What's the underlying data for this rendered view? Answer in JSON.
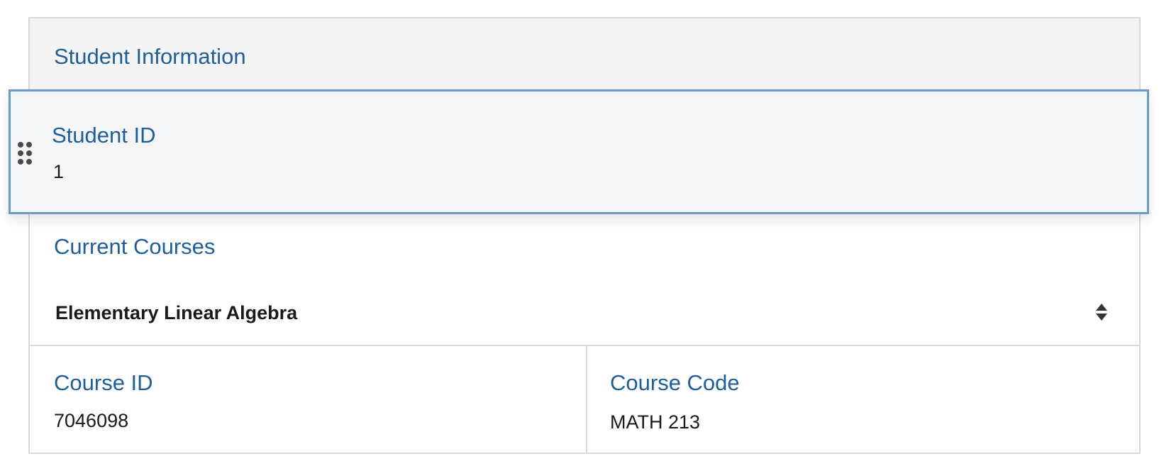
{
  "panel": {
    "title": "Student Information"
  },
  "student": {
    "id_label": "Student ID",
    "id_value": "1"
  },
  "courses": {
    "label": "Current Courses",
    "selected": "Elementary Linear Algebra"
  },
  "course_details": {
    "id_label": "Course ID",
    "id_value": "7046098",
    "code_label": "Course Code",
    "code_value": "MATH 213"
  },
  "colors": {
    "label_blue": "#1f5f99",
    "highlight_border": "#6a9bd0",
    "header_bg": "#f4f4f4",
    "border_gray": "#d9d9d9"
  },
  "icons": {
    "drag_handle": "drag-handle-icon",
    "select_arrows": "sort-arrows-icon"
  }
}
